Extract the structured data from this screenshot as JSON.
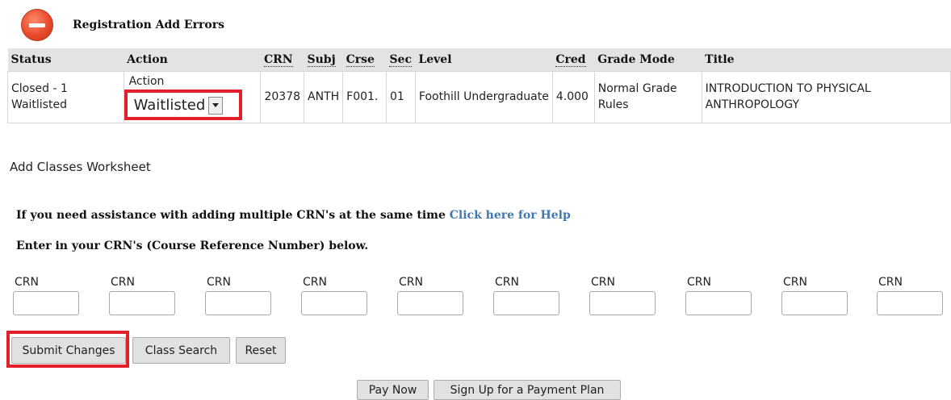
{
  "errors": {
    "title": "Registration Add Errors",
    "columns": {
      "status": "Status",
      "action": "Action",
      "crn": "CRN",
      "subj": "Subj",
      "crse": "Crse",
      "sec": "Sec",
      "level": "Level",
      "cred": "Cred",
      "grade_mode": "Grade Mode",
      "title": "Title"
    },
    "row": {
      "status": "Closed - 1 Waitlisted",
      "action_label": "Action",
      "action_value": "Waitlisted",
      "crn": "20378",
      "subj": "ANTH",
      "crse": "F001.",
      "sec": "01",
      "level": "Foothill Undergraduate",
      "cred": "4.000",
      "grade_mode": "Normal Grade Rules",
      "title": "INTRODUCTION TO PHYSICAL ANTHROPOLOGY"
    }
  },
  "worksheet": {
    "title": "Add Classes Worksheet",
    "help_text": "If you need assistance with adding multiple CRN's at the same time",
    "help_link": "Click here for Help",
    "enter_text": "Enter in your CRN's (Course Reference Number) below.",
    "crn_labels": [
      "CRN",
      "CRN",
      "CRN",
      "CRN",
      "CRN",
      "CRN",
      "CRN",
      "CRN",
      "CRN",
      "CRN"
    ]
  },
  "buttons": {
    "submit": "Submit Changes",
    "class_search": "Class Search",
    "reset": "Reset",
    "pay_now": "Pay Now",
    "payment_plan": "Sign Up for a Payment Plan"
  },
  "colors": {
    "highlight": "#e3202a",
    "header_bg": "#e3e3e3",
    "link": "#3f78b4",
    "error_icon": "#e84a2c"
  },
  "icons": {
    "error": "error-minus-circle-icon",
    "dropdown": "chevron-down-icon"
  }
}
